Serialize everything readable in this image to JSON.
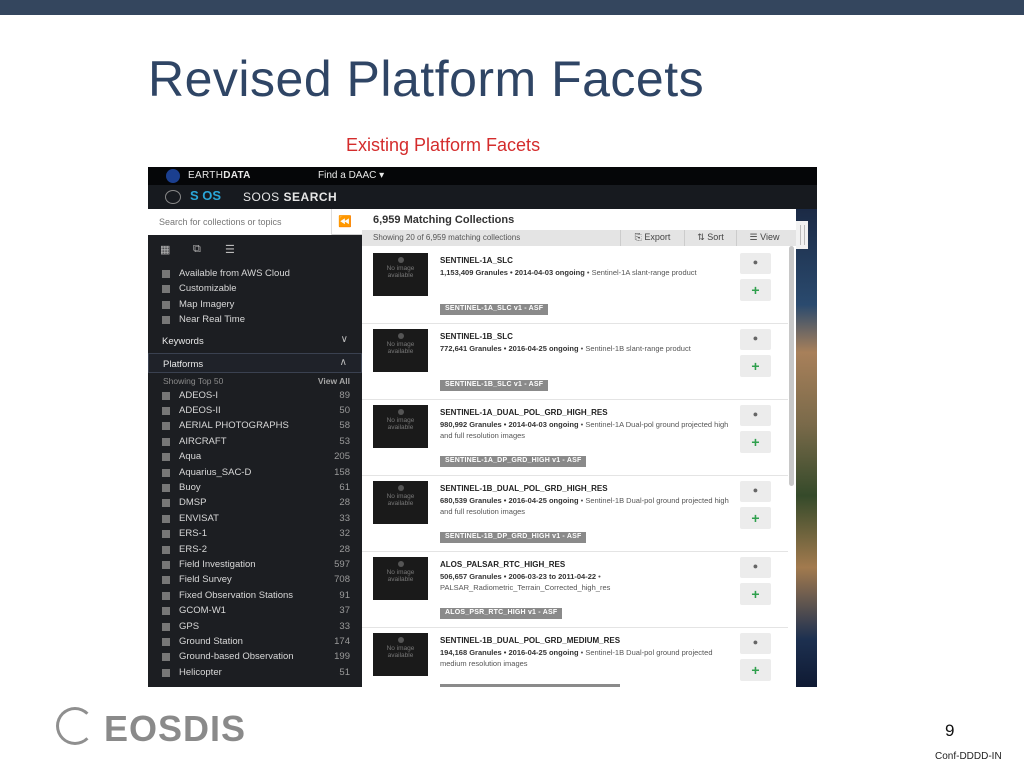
{
  "slide": {
    "title": "Revised Platform Facets",
    "subtitle": "Existing Platform Facets",
    "page_number": "9",
    "footer_code": "Conf-DDDD-IN",
    "logo_text": "EOSDIS",
    "colors": {
      "title": "#2f4565",
      "subtitle": "#d42c2c",
      "topbar": "#34465e"
    }
  },
  "app": {
    "nav": {
      "brand_prefix": "EARTH",
      "brand_bold": "DATA",
      "find_daac": "Find a DAAC ▾"
    },
    "portal": {
      "logo_text": "S  OS",
      "name_prefix": "SOOS",
      "name_bold": "SEARCH"
    },
    "search": {
      "placeholder": "Search for collections or topics",
      "value": ""
    },
    "sidebar": {
      "feature_facets": [
        {
          "label": "Available from AWS Cloud"
        },
        {
          "label": "Customizable"
        },
        {
          "label": "Map Imagery"
        },
        {
          "label": "Near Real Time"
        }
      ],
      "keywords_label": "Keywords",
      "platforms_label": "Platforms",
      "showing_label": "Showing Top 50",
      "view_all_label": "View All",
      "platforms": [
        {
          "label": "ADEOS-I",
          "count": "89"
        },
        {
          "label": "ADEOS-II",
          "count": "50"
        },
        {
          "label": "AERIAL PHOTOGRAPHS",
          "count": "58"
        },
        {
          "label": "AIRCRAFT",
          "count": "53"
        },
        {
          "label": "Aqua",
          "count": "205"
        },
        {
          "label": "Aquarius_SAC-D",
          "count": "158"
        },
        {
          "label": "Buoy",
          "count": "61"
        },
        {
          "label": "DMSP",
          "count": "28"
        },
        {
          "label": "ENVISAT",
          "count": "33"
        },
        {
          "label": "ERS-1",
          "count": "32"
        },
        {
          "label": "ERS-2",
          "count": "28"
        },
        {
          "label": "Field Investigation",
          "count": "597"
        },
        {
          "label": "Field Survey",
          "count": "708"
        },
        {
          "label": "Fixed Observation Stations",
          "count": "91"
        },
        {
          "label": "GCOM-W1",
          "count": "37"
        },
        {
          "label": "GPS",
          "count": "33"
        },
        {
          "label": "Ground Station",
          "count": "174"
        },
        {
          "label": "Ground-based Observation",
          "count": "199"
        },
        {
          "label": "Helicopter",
          "count": "51"
        }
      ]
    },
    "results": {
      "heading": "6,959 Matching Collections",
      "showing": "Showing 20 of 6,959 matching collections",
      "export_label": "Export",
      "sort_label": "Sort",
      "view_label": "View",
      "no_image_text": "No image available",
      "items": [
        {
          "title": "SENTINEL-1A_SLC",
          "meta": "1,153,409 Granules • 2014-04-03 ongoing",
          "desc": " • Sentinel-1A slant-range product",
          "badge": "SENTINEL-1A_SLC v1 - ASF"
        },
        {
          "title": "SENTINEL-1B_SLC",
          "meta": "772,641 Granules • 2016-04-25 ongoing",
          "desc": " • Sentinel-1B slant-range product",
          "badge": "SENTINEL-1B_SLC v1 - ASF"
        },
        {
          "title": "SENTINEL-1A_DUAL_POL_GRD_HIGH_RES",
          "meta": "980,992 Granules • 2014-04-03 ongoing",
          "desc": " • Sentinel-1A Dual-pol ground projected high and full resolution images",
          "badge": "SENTINEL-1A_DP_GRD_HIGH v1 - ASF"
        },
        {
          "title": "SENTINEL-1B_DUAL_POL_GRD_HIGH_RES",
          "meta": "680,539 Granules • 2016-04-25 ongoing",
          "desc": " • Sentinel-1B Dual-pol ground projected high and full resolution images",
          "badge": "SENTINEL-1B_DP_GRD_HIGH v1 - ASF"
        },
        {
          "title": "ALOS_PALSAR_RTC_HIGH_RES",
          "meta": "506,657 Granules • 2006-03-23 to 2011-04-22",
          "desc": " • PALSAR_Radiometric_Terrain_Corrected_high_res",
          "badge": "ALOS_PSR_RTC_HIGH v1 - ASF"
        },
        {
          "title": "SENTINEL-1B_DUAL_POL_GRD_MEDIUM_RES",
          "meta": "194,168 Granules • 2016-04-25 ongoing",
          "desc": " • Sentinel-1B Dual-pol ground projected medium resolution images",
          "badge": ""
        }
      ]
    }
  }
}
